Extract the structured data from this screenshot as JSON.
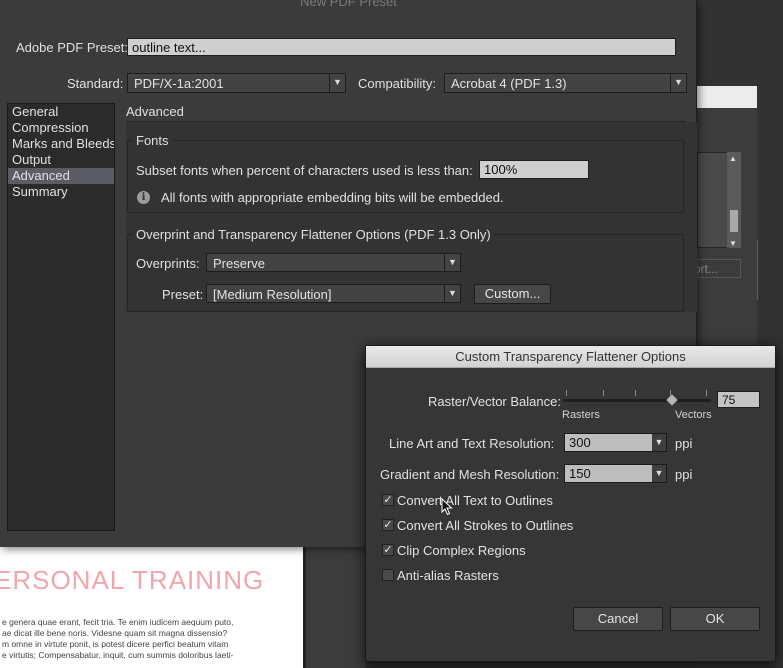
{
  "background": {
    "doc_heading": "ERSONAL TRAINING",
    "doc_body": "e genera quae erant, fecit tria. Te enim iudicem aequum puto,\nae dicat ille bene noris. Videsne quam sit magna dissensio?\nm omne in virtute ponit, is potest dicere perfici beatum vitam\ne virtutis; Compensabatur, inquit, cum summis doloribus laeti-\n...",
    "side_button": "ort..."
  },
  "main_dialog": {
    "title": "New PDF Preset",
    "preset_label": "Adobe PDF Preset:",
    "preset_value": "outline text...",
    "standard_label": "Standard:",
    "standard_value": "PDF/X-1a:2001",
    "compatibility_label": "Compatibility:",
    "compatibility_value": "Acrobat 4 (PDF 1.3)",
    "sidebar": [
      {
        "label": "General",
        "selected": false
      },
      {
        "label": "Compression",
        "selected": false
      },
      {
        "label": "Marks and Bleeds",
        "selected": false
      },
      {
        "label": "Output",
        "selected": false
      },
      {
        "label": "Advanced",
        "selected": true
      },
      {
        "label": "Summary",
        "selected": false
      }
    ],
    "section_title": "Advanced",
    "fonts": {
      "legend": "Fonts",
      "subset_label": "Subset fonts when percent of characters used is less than:",
      "subset_value": "100%",
      "info_text": "All fonts with appropriate embedding bits will be embedded."
    },
    "flattener": {
      "legend": "Overprint and Transparency Flattener Options (PDF 1.3 Only)",
      "overprints_label": "Overprints:",
      "overprints_value": "Preserve",
      "preset_label": "Preset:",
      "preset_value": "[Medium Resolution]",
      "custom_button": "Custom..."
    }
  },
  "flattener_dialog": {
    "title": "Custom Transparency Flattener Options",
    "balance_label": "Raster/Vector Balance:",
    "balance_value": "75",
    "balance_level": 75,
    "rasters_label": "Rasters",
    "vectors_label": "Vectors",
    "line_art_label": "Line Art and Text Resolution:",
    "line_art_value": "300",
    "line_art_unit": "ppi",
    "gradient_label": "Gradient and Mesh Resolution:",
    "gradient_value": "150",
    "gradient_unit": "ppi",
    "checkboxes": [
      {
        "label": "Convert All Text to Outlines",
        "checked": true
      },
      {
        "label": "Convert All Strokes to Outlines",
        "checked": true
      },
      {
        "label": "Clip Complex Regions",
        "checked": true
      },
      {
        "label": "Anti-alias Rasters",
        "checked": false
      }
    ],
    "cancel_button": "Cancel",
    "ok_button": "OK"
  }
}
